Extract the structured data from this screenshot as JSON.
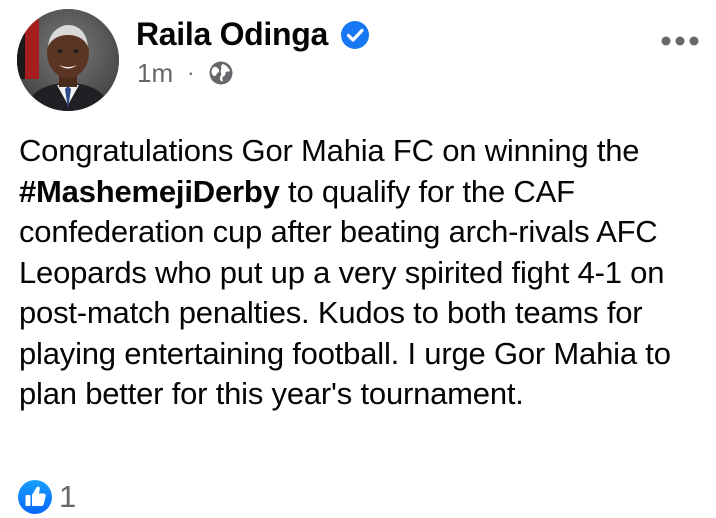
{
  "post": {
    "author": "Raila Odinga",
    "verified_icon": "verified-badge-icon",
    "timestamp": "1m",
    "separator": "·",
    "audience_icon": "globe-icon",
    "more_icon": "more-options-icon",
    "text_before": "Congratulations Gor Mahia FC on winning the ",
    "hashtag": "#MashemejiDerby",
    "text_after": " to qualify for the CAF confederation cup after beating arch-rivals AFC Leopards who put up a very spirited fight 4-1 on post-match penalties. Kudos to both teams for playing entertaining football. I urge Gor Mahia to plan better for this year's tournament."
  },
  "reactions": {
    "icon": "like-reaction-icon",
    "count": "1"
  },
  "colors": {
    "verified_blue": "#1877f2",
    "secondary_text": "#65676b",
    "primary_text": "#050505",
    "like_blue": "#1877f2"
  }
}
